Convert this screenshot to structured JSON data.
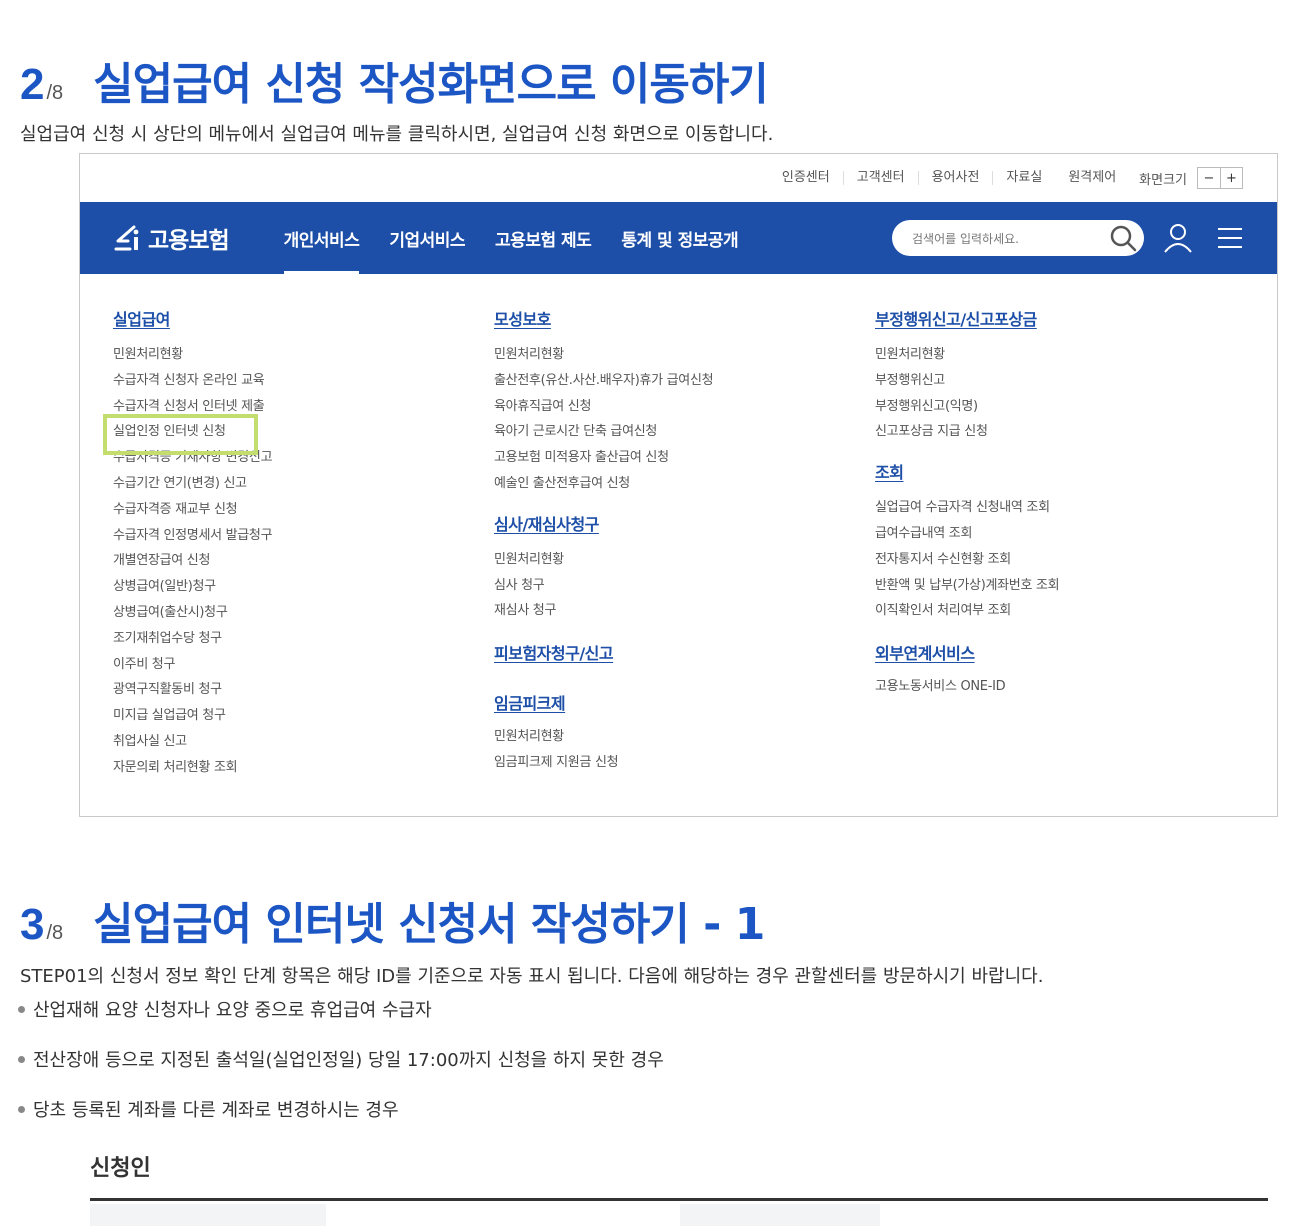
{
  "step2": {
    "num": "2",
    "total": "/8",
    "heading": "실업급여 신청 작성화면으로 이동하기",
    "desc": "실업급여 신청 시 상단의 메뉴에서 실업급여 메뉴를 클릭하시면, 실업급여 신청 화면으로 이동합니다."
  },
  "util": {
    "links": [
      "인증센터",
      "고객센터",
      "용어사전",
      "자료실",
      "원격제어"
    ],
    "zoom_label": "화면크기",
    "zoom_minus": "−",
    "zoom_plus": "+"
  },
  "nav": {
    "logo": "고용보험",
    "items": [
      "개인서비스",
      "기업서비스",
      "고용보험 제도",
      "통계 및 정보공개"
    ],
    "active_index": 0,
    "search_placeholder": "검색어를 입력하세요."
  },
  "mega": {
    "col1": {
      "category": "실업급여",
      "items": [
        "민원처리현황",
        "수급자격 신청자 온라인 교육",
        "수급자격 신청서 인터넷 제출",
        "실업인정 인터넷 신청",
        "수급자격증 기재사항 변경신고",
        "수급기간 연기(변경) 신고",
        "수급자격증 재교부 신청",
        "수급자격 인정명세서 발급청구",
        "개별연장급여 신청",
        "상병급여(일반)청구",
        "상병급여(출산시)청구",
        "조기재취업수당 청구",
        "이주비 청구",
        "광역구직활동비 청구",
        "미지급 실업급여 청구",
        "취업사실 신고",
        "자문의뢰 처리현황 조회"
      ],
      "highlighted_index": 3
    },
    "col2": {
      "groups": [
        {
          "category": "모성보호",
          "items": [
            "민원처리현황",
            "출산전후(유산.사산.배우자)휴가 급여신청",
            "육아휴직급여 신청",
            "육아기 근로시간 단축 급여신청",
            "고용보험 미적용자 출산급여 신청",
            "예술인 출산전후급여 신청"
          ]
        },
        {
          "category": "심사/재심사청구",
          "items": [
            "민원처리현황",
            "심사 청구",
            "재심사 청구"
          ]
        },
        {
          "category": "피보험자청구/신고",
          "items": []
        },
        {
          "category": "임금피크제",
          "items": [
            "민원처리현황",
            "임금피크제 지원금 신청"
          ]
        }
      ]
    },
    "col3": {
      "groups": [
        {
          "category": "부정행위신고/신고포상금",
          "items": [
            "민원처리현황",
            "부정행위신고",
            "부정행위신고(익명)",
            "신고포상금 지급 신청"
          ]
        },
        {
          "category": "조회",
          "items": [
            "실업급여 수급자격 신청내역 조회",
            "급여수급내역 조회",
            "전자통지서 수신현황 조회",
            "반환액 및 납부(가상)계좌번호 조회",
            "이직확인서 처리여부 조회"
          ]
        },
        {
          "category": "외부연계서비스",
          "items": [
            "고용노동서비스 ONE-ID"
          ]
        }
      ]
    }
  },
  "step3": {
    "num": "3",
    "total": "/8",
    "heading": "실업급여 인터넷 신청서 작성하기 - 1",
    "desc": "STEP01의 신청서 정보 확인 단계 항목은 해당 ID를 기준으로 자동 표시 됩니다. 다음에 해당하는 경우 관할센터를 방문하시기 바랍니다.",
    "bullets": [
      "산업재해 요양 신청자나 요양 중으로 휴업급여 수급자",
      "전산장애 등으로 지정된 출석일(실업인정일) 당일 17:00까지 신청을 하지 못한 경우",
      "당초 등록된 계좌를 다른 계좌로 변경하시는 경우"
    ],
    "section_title": "신청인"
  },
  "colors": {
    "accent": "#1c56c4",
    "navbar": "#1d4fa8",
    "highlight": "#c3dd6e"
  }
}
